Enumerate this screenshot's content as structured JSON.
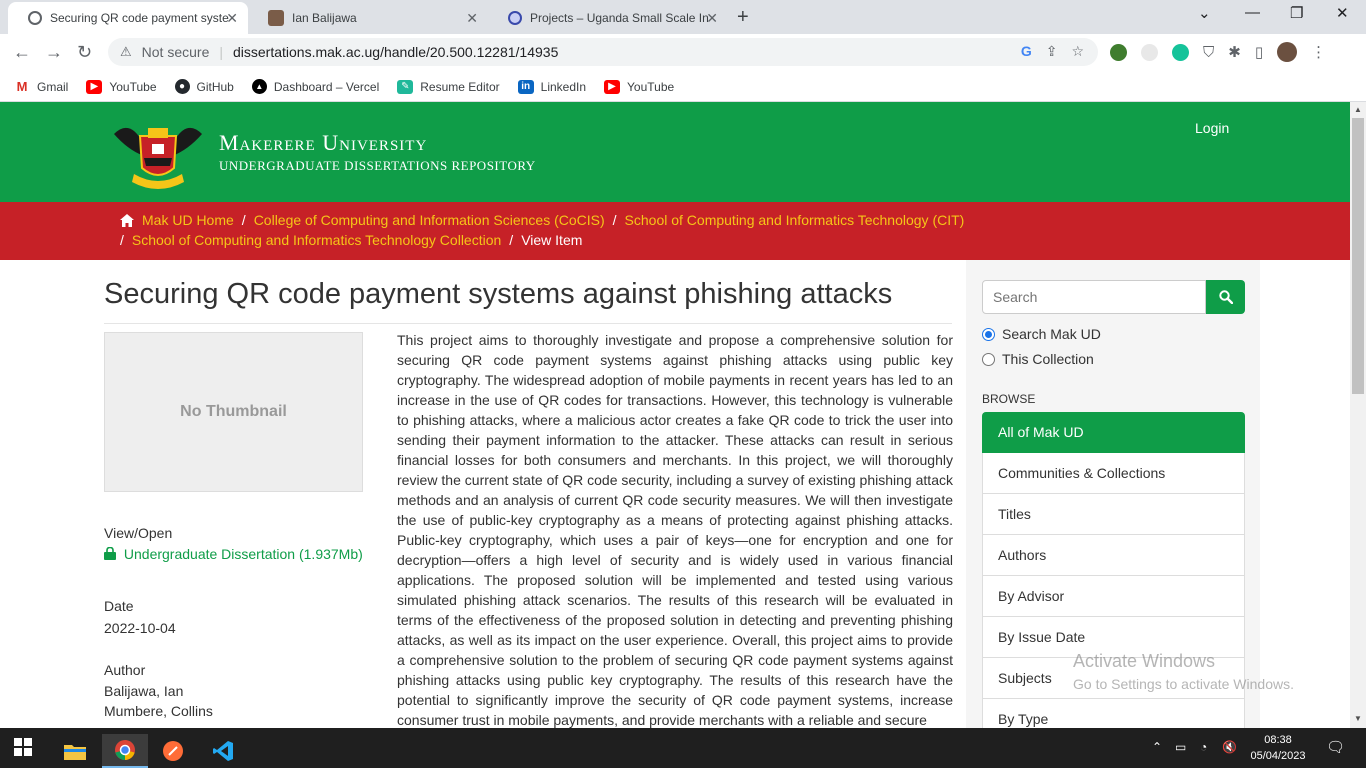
{
  "browser": {
    "tabs": [
      {
        "title": "Securing QR code payment syste",
        "active": true
      },
      {
        "title": "Ian Balijawa",
        "active": false
      },
      {
        "title": "Projects – Uganda Small Scale In",
        "active": false
      }
    ],
    "security_label": "Not secure",
    "url": "dissertations.mak.ac.ug/handle/20.500.12281/14935",
    "bookmarks": [
      "Gmail",
      "YouTube",
      "GitHub",
      "Dashboard – Vercel",
      "Resume Editor",
      "LinkedIn",
      "YouTube"
    ]
  },
  "site": {
    "name": "Makerere University",
    "subtitle": "Undergraduate Dissertations Repository",
    "login_label": "Login"
  },
  "breadcrumb": {
    "items": [
      "Mak UD Home",
      "College of Computing and Information Sciences (CoCIS)",
      "School of Computing and Informatics Technology (CIT)",
      "School of Computing and Informatics Technology Collection"
    ],
    "current": "View Item"
  },
  "item": {
    "title": "Securing QR code payment systems against phishing attacks",
    "thumbnail_text": "No Thumbnail",
    "view_open_label": "View/Open",
    "file_link": "Undergraduate Dissertation (1.937Mb)",
    "date_label": "Date",
    "date": "2022-10-04",
    "author_label": "Author",
    "authors": [
      "Balijawa, Ian",
      "Mumbere, Collins"
    ],
    "abstract": "This project aims to thoroughly investigate and propose a comprehensive solution for securing QR code payment systems against phishing attacks using public key cryptography. The widespread adoption of mobile payments in recent years has led to an increase in the use of QR codes for transactions. However, this technology is vulnerable to phishing attacks, where a malicious actor creates a fake QR code to trick the user into sending their payment information to the attacker. These attacks can result in serious financial losses for both consumers and merchants. In this project, we will thoroughly review the current state of QR code security, including a survey of existing phishing attack methods and an analysis of current QR code security measures. We will then investigate the use of public-key cryptography as a means of protecting against phishing attacks. Public-key cryptography, which uses a pair of keys—one for encryption and one for decryption—offers a high level of security and is widely used in various financial applications. The proposed solution will be implemented and tested using various simulated phishing attack scenarios. The results of this research will be evaluated in terms of the effectiveness of the proposed solution in detecting and preventing phishing attacks, as well as its impact on the user experience. Overall, this project aims to provide a comprehensive solution to the problem of securing QR code payment systems against phishing attacks using public key cryptography. The results of this research have the potential to significantly improve the security of QR code payment systems, increase consumer trust in mobile payments, and provide merchants with a reliable and secure"
  },
  "sidebar": {
    "search_placeholder": "Search",
    "scope_options": [
      "Search Mak UD",
      "This Collection"
    ],
    "selected_scope": "Search Mak UD",
    "browse_heading": "BROWSE",
    "browse_items": [
      "All of Mak UD",
      "Communities & Collections",
      "Titles",
      "Authors",
      "By Advisor",
      "By Issue Date",
      "Subjects",
      "By Type"
    ],
    "active_browse": "All of Mak UD"
  },
  "watermark": {
    "line1": "Activate Windows",
    "line2": "Go to Settings to activate Windows."
  },
  "taskbar": {
    "time": "08:38",
    "date": "05/04/2023"
  },
  "colors": {
    "brand_green": "#0f9d48",
    "brand_red": "#c62127",
    "crumb_link": "#f5c518"
  }
}
